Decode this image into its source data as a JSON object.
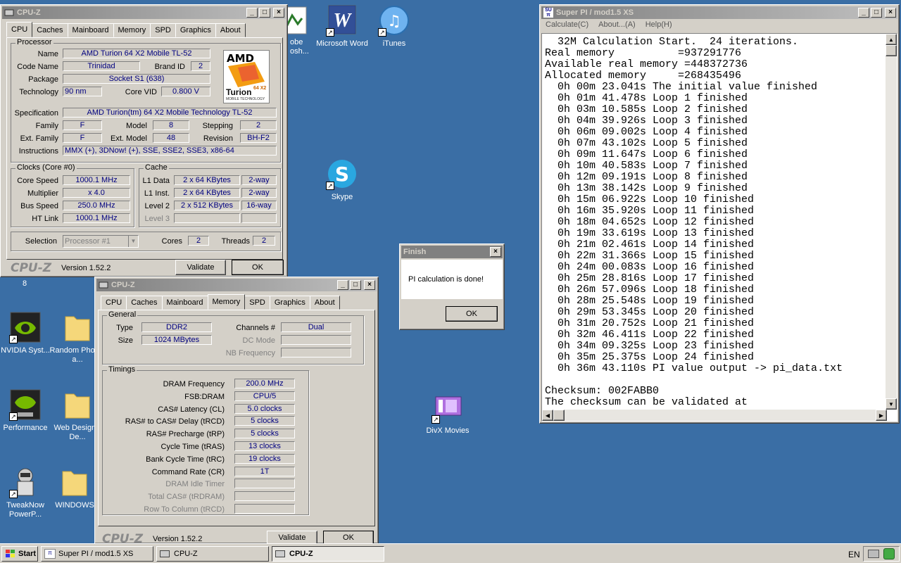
{
  "desktop": {
    "icons": [
      {
        "label": "Adobe Photosh...",
        "name": "adobe-photoshop-icon"
      },
      {
        "label": "Microsoft Word",
        "name": "word-icon"
      },
      {
        "label": "iTunes",
        "name": "itunes-icon"
      },
      {
        "label": "Skype",
        "name": "skype-icon"
      },
      {
        "label": "DivX Movies",
        "name": "divx-icon"
      },
      {
        "label": "NVIDIA Syst...",
        "name": "nvidia-icon"
      },
      {
        "label": "Random Photos a...",
        "name": "folder-icon"
      },
      {
        "label": "Performance",
        "name": "nvidia-performance-icon"
      },
      {
        "label": "Web Design--De...",
        "name": "folder-icon"
      },
      {
        "label": "TweakNow PowerP...",
        "name": "tweaknow-icon"
      },
      {
        "label": "WINDOWS",
        "name": "folder-icon"
      },
      {
        "label": "8",
        "name": "label"
      }
    ]
  },
  "cpuz1": {
    "title": "CPU-Z",
    "tabs": [
      "CPU",
      "Caches",
      "Mainboard",
      "Memory",
      "SPD",
      "Graphics",
      "About"
    ],
    "processor_label": "Processor",
    "name_l": "Name",
    "name_v": "AMD Turion 64 X2 Mobile TL-52",
    "codename_l": "Code Name",
    "codename_v": "Trinidad",
    "brandid_l": "Brand ID",
    "brandid_v": "2",
    "package_l": "Package",
    "package_v": "Socket S1 (638)",
    "tech_l": "Technology",
    "tech_v": "90 nm",
    "corevid_l": "Core VID",
    "corevid_v": "0.800 V",
    "spec_l": "Specification",
    "spec_v": "AMD Turion(tm) 64 X2 Mobile Technology TL-52",
    "family_l": "Family",
    "family_v": "F",
    "model_l": "Model",
    "model_v": "8",
    "stepping_l": "Stepping",
    "stepping_v": "2",
    "extfamily_l": "Ext. Family",
    "extfamily_v": "F",
    "extmodel_l": "Ext. Model",
    "extmodel_v": "48",
    "revision_l": "Revision",
    "revision_v": "BH-F2",
    "instr_l": "Instructions",
    "instr_v": "MMX (+), 3DNow! (+), SSE, SSE2, SSE3, x86-64",
    "clocks_label": "Clocks (Core #0)",
    "corespeed_l": "Core Speed",
    "corespeed_v": "1000.1 MHz",
    "mult_l": "Multiplier",
    "mult_v": "x 4.0",
    "bus_l": "Bus Speed",
    "bus_v": "250.0 MHz",
    "ht_l": "HT Link",
    "ht_v": "1000.1 MHz",
    "cache_label": "Cache",
    "l1d_l": "L1 Data",
    "l1d_v": "2 x 64 KBytes",
    "l1d_w": "2-way",
    "l1i_l": "L1 Inst.",
    "l1i_v": "2 x 64 KBytes",
    "l1i_w": "2-way",
    "l2_l": "Level 2",
    "l2_v": "2 x 512 KBytes",
    "l2_w": "16-way",
    "l3_l": "Level 3",
    "sel_l": "Selection",
    "sel_v": "Processor #1",
    "cores_l": "Cores",
    "cores_v": "2",
    "threads_l": "Threads",
    "threads_v": "2",
    "logo": "CPU-Z",
    "version": "Version 1.52.2",
    "validate": "Validate",
    "ok": "OK",
    "amd_logo": "AMD",
    "turion_text": "Turion",
    "turion_sub": "64 X2",
    "turion_mobile": "MOBILE TECHNOLOGY"
  },
  "cpuz2": {
    "title": "CPU-Z",
    "tabs": [
      "CPU",
      "Caches",
      "Mainboard",
      "Memory",
      "SPD",
      "Graphics",
      "About"
    ],
    "general_label": "General",
    "type_l": "Type",
    "type_v": "DDR2",
    "size_l": "Size",
    "size_v": "1024 MBytes",
    "channels_l": "Channels #",
    "channels_v": "Dual",
    "dcmode_l": "DC Mode",
    "nbfreq_l": "NB Frequency",
    "timings_label": "Timings",
    "rows": [
      {
        "l": "DRAM Frequency",
        "v": "200.0 MHz",
        "dis": false
      },
      {
        "l": "FSB:DRAM",
        "v": "CPU/5",
        "dis": false
      },
      {
        "l": "CAS# Latency (CL)",
        "v": "5.0 clocks",
        "dis": false
      },
      {
        "l": "RAS# to CAS# Delay (tRCD)",
        "v": "5 clocks",
        "dis": false
      },
      {
        "l": "RAS# Precharge (tRP)",
        "v": "5 clocks",
        "dis": false
      },
      {
        "l": "Cycle Time (tRAS)",
        "v": "13 clocks",
        "dis": false
      },
      {
        "l": "Bank Cycle Time (tRC)",
        "v": "19 clocks",
        "dis": false
      },
      {
        "l": "Command Rate (CR)",
        "v": "1T",
        "dis": false
      },
      {
        "l": "DRAM Idle Timer",
        "v": "",
        "dis": true
      },
      {
        "l": "Total CAS# (tRDRAM)",
        "v": "",
        "dis": true
      },
      {
        "l": "Row To Column (tRCD)",
        "v": "",
        "dis": true
      }
    ],
    "logo": "CPU-Z",
    "version": "Version 1.52.2",
    "validate": "Validate",
    "ok": "OK"
  },
  "finish": {
    "title": "Finish",
    "message": "PI calculation is done!",
    "ok": "OK"
  },
  "superpi": {
    "title": "Super PI / mod1.5 XS",
    "menu": [
      "Calculate(C)",
      "About...(A)",
      "Help(H)"
    ],
    "lines": [
      "  32M Calculation Start.  24 iterations.",
      "Real memory          =937291776",
      "Available real memory =448372736",
      "Allocated memory     =268435496",
      "  0h 00m 23.041s The initial value finished",
      "  0h 01m 41.478s Loop 1 finished",
      "  0h 03m 10.585s Loop 2 finished",
      "  0h 04m 39.926s Loop 3 finished",
      "  0h 06m 09.002s Loop 4 finished",
      "  0h 07m 43.102s Loop 5 finished",
      "  0h 09m 11.647s Loop 6 finished",
      "  0h 10m 40.583s Loop 7 finished",
      "  0h 12m 09.191s Loop 8 finished",
      "  0h 13m 38.142s Loop 9 finished",
      "  0h 15m 06.922s Loop 10 finished",
      "  0h 16m 35.920s Loop 11 finished",
      "  0h 18m 04.652s Loop 12 finished",
      "  0h 19m 33.619s Loop 13 finished",
      "  0h 21m 02.461s Loop 14 finished",
      "  0h 22m 31.366s Loop 15 finished",
      "  0h 24m 00.083s Loop 16 finished",
      "  0h 25m 28.816s Loop 17 finished",
      "  0h 26m 57.096s Loop 18 finished",
      "  0h 28m 25.548s Loop 19 finished",
      "  0h 29m 53.345s Loop 20 finished",
      "  0h 31m 20.752s Loop 21 finished",
      "  0h 32m 46.411s Loop 22 finished",
      "  0h 34m 09.325s Loop 23 finished",
      "  0h 35m 25.375s Loop 24 finished",
      "  0h 36m 43.110s PI value output -> pi_data.txt",
      "",
      "Checksum: 002FABB0",
      "The checksum can be validated at"
    ]
  },
  "taskbar": {
    "start": "Start",
    "items": [
      "Super PI / mod1.5 XS",
      "CPU-Z",
      "CPU-Z"
    ],
    "lang": "EN"
  }
}
